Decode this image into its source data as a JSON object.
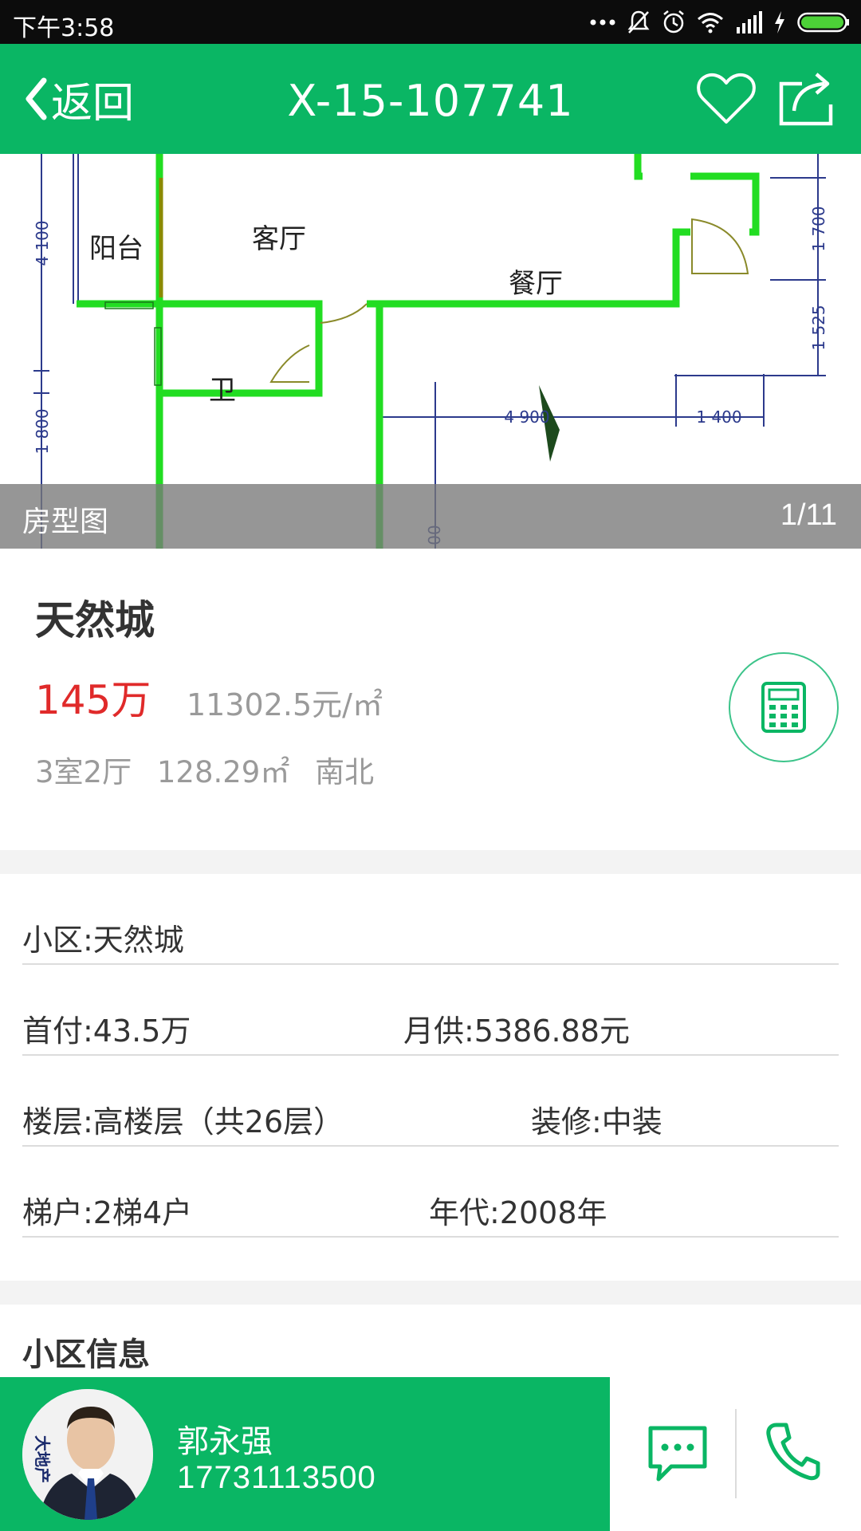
{
  "status_bar": {
    "time": "下午3:58"
  },
  "nav": {
    "back_label": "返回",
    "title": "X-15-107741"
  },
  "hero": {
    "caption": "房型图",
    "counter": "1/11",
    "floorplan_labels": {
      "balcony": "阳台",
      "living": "客厅",
      "dining": "餐厅",
      "bath": "卫",
      "dim_4100": "4 100",
      "dim_1800": "1 800",
      "dim_1700": "1 700",
      "dim_1525": "1 525",
      "dim_4900": "4 900",
      "dim_1400": "1 400",
      "dim_00": "00"
    }
  },
  "summary": {
    "name": "天然城",
    "price": "145万",
    "unit_price": "11302.5元/㎡",
    "layout": "3室2厅",
    "area": "128.29㎡",
    "orientation": "南北"
  },
  "details": {
    "estate": "小区:天然城",
    "down_payment": "首付:43.5万",
    "monthly": "月供:5386.88元",
    "floor": "楼层:高楼层（共26层）",
    "decoration": "装修:中装",
    "elevator": "梯户:2梯4户",
    "year": "年代:2008年"
  },
  "section_community": "小区信息",
  "agent": {
    "name": "郭永强",
    "phone": "17731113500",
    "badge_text": "大地产"
  },
  "colors": {
    "brand_green": "#0ab664",
    "price_red": "#e02a2a",
    "muted_gray": "#9a9a9a"
  },
  "icons": [
    "back-chevron-icon",
    "heart-icon",
    "share-icon",
    "calculator-icon",
    "chat-icon",
    "phone-icon"
  ]
}
